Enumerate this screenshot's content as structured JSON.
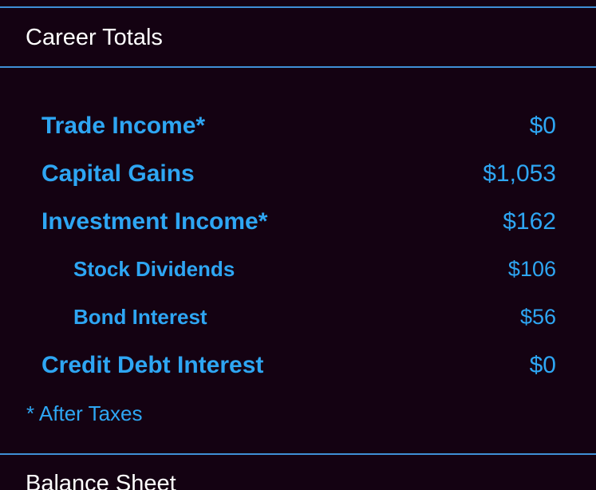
{
  "sections": {
    "career_totals": {
      "title": "Career Totals",
      "rows": [
        {
          "label": "Trade Income*",
          "value": "$0"
        },
        {
          "label": "Capital Gains",
          "value": "$1,053"
        },
        {
          "label": "Investment Income*",
          "value": "$162"
        },
        {
          "label": "Stock Dividends",
          "value": "$106"
        },
        {
          "label": "Bond Interest",
          "value": "$56"
        },
        {
          "label": "Credit Debt Interest",
          "value": "$0"
        }
      ],
      "footnote": "* After Taxes"
    },
    "balance_sheet": {
      "title": "Balance Sheet"
    }
  },
  "colors": {
    "background": "#140212",
    "accent": "#2ea6f3",
    "divider": "#3f8fd6",
    "title_text": "#ffffff"
  }
}
